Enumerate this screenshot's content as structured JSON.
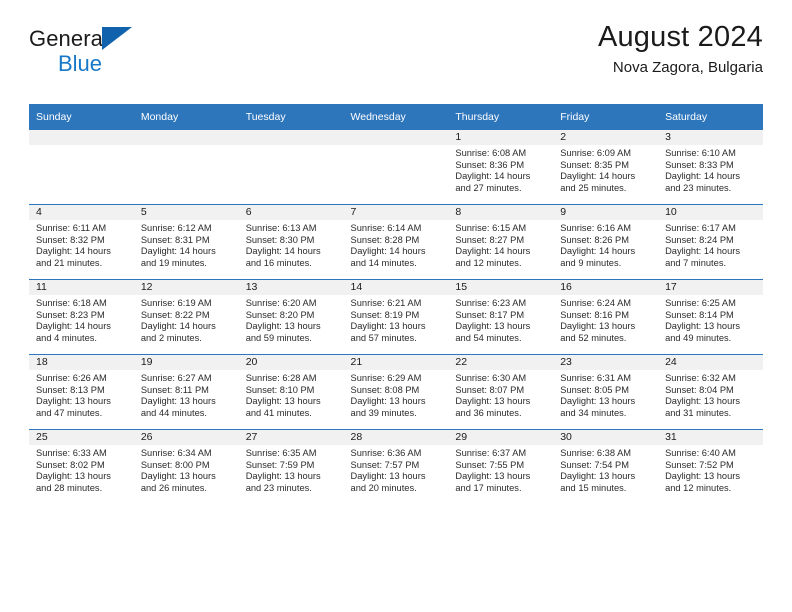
{
  "brand": {
    "name_top": "General",
    "name_bottom": "Blue",
    "triangle_icon": "blue-triangle-logo-icon",
    "color_top": "#1b1b1b",
    "color_bottom": "#1878c8",
    "triangle_color": "#1162ad"
  },
  "header": {
    "title": "August 2024",
    "subtitle": "Nova Zagora, Bulgaria"
  },
  "theme": {
    "header_blue": "#2e76bc",
    "daynum_bg": "#f1f1f1",
    "text": "#1b1b1b"
  },
  "weekdays": [
    "Sunday",
    "Monday",
    "Tuesday",
    "Wednesday",
    "Thursday",
    "Friday",
    "Saturday"
  ],
  "weeks": [
    [
      {
        "day": "",
        "sunrise": "",
        "sunset": "",
        "daylight_line1": "",
        "daylight_line2": ""
      },
      {
        "day": "",
        "sunrise": "",
        "sunset": "",
        "daylight_line1": "",
        "daylight_line2": ""
      },
      {
        "day": "",
        "sunrise": "",
        "sunset": "",
        "daylight_line1": "",
        "daylight_line2": ""
      },
      {
        "day": "",
        "sunrise": "",
        "sunset": "",
        "daylight_line1": "",
        "daylight_line2": ""
      },
      {
        "day": "1",
        "sunrise": "Sunrise: 6:08 AM",
        "sunset": "Sunset: 8:36 PM",
        "daylight_line1": "Daylight: 14 hours",
        "daylight_line2": "and 27 minutes."
      },
      {
        "day": "2",
        "sunrise": "Sunrise: 6:09 AM",
        "sunset": "Sunset: 8:35 PM",
        "daylight_line1": "Daylight: 14 hours",
        "daylight_line2": "and 25 minutes."
      },
      {
        "day": "3",
        "sunrise": "Sunrise: 6:10 AM",
        "sunset": "Sunset: 8:33 PM",
        "daylight_line1": "Daylight: 14 hours",
        "daylight_line2": "and 23 minutes."
      }
    ],
    [
      {
        "day": "4",
        "sunrise": "Sunrise: 6:11 AM",
        "sunset": "Sunset: 8:32 PM",
        "daylight_line1": "Daylight: 14 hours",
        "daylight_line2": "and 21 minutes."
      },
      {
        "day": "5",
        "sunrise": "Sunrise: 6:12 AM",
        "sunset": "Sunset: 8:31 PM",
        "daylight_line1": "Daylight: 14 hours",
        "daylight_line2": "and 19 minutes."
      },
      {
        "day": "6",
        "sunrise": "Sunrise: 6:13 AM",
        "sunset": "Sunset: 8:30 PM",
        "daylight_line1": "Daylight: 14 hours",
        "daylight_line2": "and 16 minutes."
      },
      {
        "day": "7",
        "sunrise": "Sunrise: 6:14 AM",
        "sunset": "Sunset: 8:28 PM",
        "daylight_line1": "Daylight: 14 hours",
        "daylight_line2": "and 14 minutes."
      },
      {
        "day": "8",
        "sunrise": "Sunrise: 6:15 AM",
        "sunset": "Sunset: 8:27 PM",
        "daylight_line1": "Daylight: 14 hours",
        "daylight_line2": "and 12 minutes."
      },
      {
        "day": "9",
        "sunrise": "Sunrise: 6:16 AM",
        "sunset": "Sunset: 8:26 PM",
        "daylight_line1": "Daylight: 14 hours",
        "daylight_line2": "and 9 minutes."
      },
      {
        "day": "10",
        "sunrise": "Sunrise: 6:17 AM",
        "sunset": "Sunset: 8:24 PM",
        "daylight_line1": "Daylight: 14 hours",
        "daylight_line2": "and 7 minutes."
      }
    ],
    [
      {
        "day": "11",
        "sunrise": "Sunrise: 6:18 AM",
        "sunset": "Sunset: 8:23 PM",
        "daylight_line1": "Daylight: 14 hours",
        "daylight_line2": "and 4 minutes."
      },
      {
        "day": "12",
        "sunrise": "Sunrise: 6:19 AM",
        "sunset": "Sunset: 8:22 PM",
        "daylight_line1": "Daylight: 14 hours",
        "daylight_line2": "and 2 minutes."
      },
      {
        "day": "13",
        "sunrise": "Sunrise: 6:20 AM",
        "sunset": "Sunset: 8:20 PM",
        "daylight_line1": "Daylight: 13 hours",
        "daylight_line2": "and 59 minutes."
      },
      {
        "day": "14",
        "sunrise": "Sunrise: 6:21 AM",
        "sunset": "Sunset: 8:19 PM",
        "daylight_line1": "Daylight: 13 hours",
        "daylight_line2": "and 57 minutes."
      },
      {
        "day": "15",
        "sunrise": "Sunrise: 6:23 AM",
        "sunset": "Sunset: 8:17 PM",
        "daylight_line1": "Daylight: 13 hours",
        "daylight_line2": "and 54 minutes."
      },
      {
        "day": "16",
        "sunrise": "Sunrise: 6:24 AM",
        "sunset": "Sunset: 8:16 PM",
        "daylight_line1": "Daylight: 13 hours",
        "daylight_line2": "and 52 minutes."
      },
      {
        "day": "17",
        "sunrise": "Sunrise: 6:25 AM",
        "sunset": "Sunset: 8:14 PM",
        "daylight_line1": "Daylight: 13 hours",
        "daylight_line2": "and 49 minutes."
      }
    ],
    [
      {
        "day": "18",
        "sunrise": "Sunrise: 6:26 AM",
        "sunset": "Sunset: 8:13 PM",
        "daylight_line1": "Daylight: 13 hours",
        "daylight_line2": "and 47 minutes."
      },
      {
        "day": "19",
        "sunrise": "Sunrise: 6:27 AM",
        "sunset": "Sunset: 8:11 PM",
        "daylight_line1": "Daylight: 13 hours",
        "daylight_line2": "and 44 minutes."
      },
      {
        "day": "20",
        "sunrise": "Sunrise: 6:28 AM",
        "sunset": "Sunset: 8:10 PM",
        "daylight_line1": "Daylight: 13 hours",
        "daylight_line2": "and 41 minutes."
      },
      {
        "day": "21",
        "sunrise": "Sunrise: 6:29 AM",
        "sunset": "Sunset: 8:08 PM",
        "daylight_line1": "Daylight: 13 hours",
        "daylight_line2": "and 39 minutes."
      },
      {
        "day": "22",
        "sunrise": "Sunrise: 6:30 AM",
        "sunset": "Sunset: 8:07 PM",
        "daylight_line1": "Daylight: 13 hours",
        "daylight_line2": "and 36 minutes."
      },
      {
        "day": "23",
        "sunrise": "Sunrise: 6:31 AM",
        "sunset": "Sunset: 8:05 PM",
        "daylight_line1": "Daylight: 13 hours",
        "daylight_line2": "and 34 minutes."
      },
      {
        "day": "24",
        "sunrise": "Sunrise: 6:32 AM",
        "sunset": "Sunset: 8:04 PM",
        "daylight_line1": "Daylight: 13 hours",
        "daylight_line2": "and 31 minutes."
      }
    ],
    [
      {
        "day": "25",
        "sunrise": "Sunrise: 6:33 AM",
        "sunset": "Sunset: 8:02 PM",
        "daylight_line1": "Daylight: 13 hours",
        "daylight_line2": "and 28 minutes."
      },
      {
        "day": "26",
        "sunrise": "Sunrise: 6:34 AM",
        "sunset": "Sunset: 8:00 PM",
        "daylight_line1": "Daylight: 13 hours",
        "daylight_line2": "and 26 minutes."
      },
      {
        "day": "27",
        "sunrise": "Sunrise: 6:35 AM",
        "sunset": "Sunset: 7:59 PM",
        "daylight_line1": "Daylight: 13 hours",
        "daylight_line2": "and 23 minutes."
      },
      {
        "day": "28",
        "sunrise": "Sunrise: 6:36 AM",
        "sunset": "Sunset: 7:57 PM",
        "daylight_line1": "Daylight: 13 hours",
        "daylight_line2": "and 20 minutes."
      },
      {
        "day": "29",
        "sunrise": "Sunrise: 6:37 AM",
        "sunset": "Sunset: 7:55 PM",
        "daylight_line1": "Daylight: 13 hours",
        "daylight_line2": "and 17 minutes."
      },
      {
        "day": "30",
        "sunrise": "Sunrise: 6:38 AM",
        "sunset": "Sunset: 7:54 PM",
        "daylight_line1": "Daylight: 13 hours",
        "daylight_line2": "and 15 minutes."
      },
      {
        "day": "31",
        "sunrise": "Sunrise: 6:40 AM",
        "sunset": "Sunset: 7:52 PM",
        "daylight_line1": "Daylight: 13 hours",
        "daylight_line2": "and 12 minutes."
      }
    ]
  ]
}
